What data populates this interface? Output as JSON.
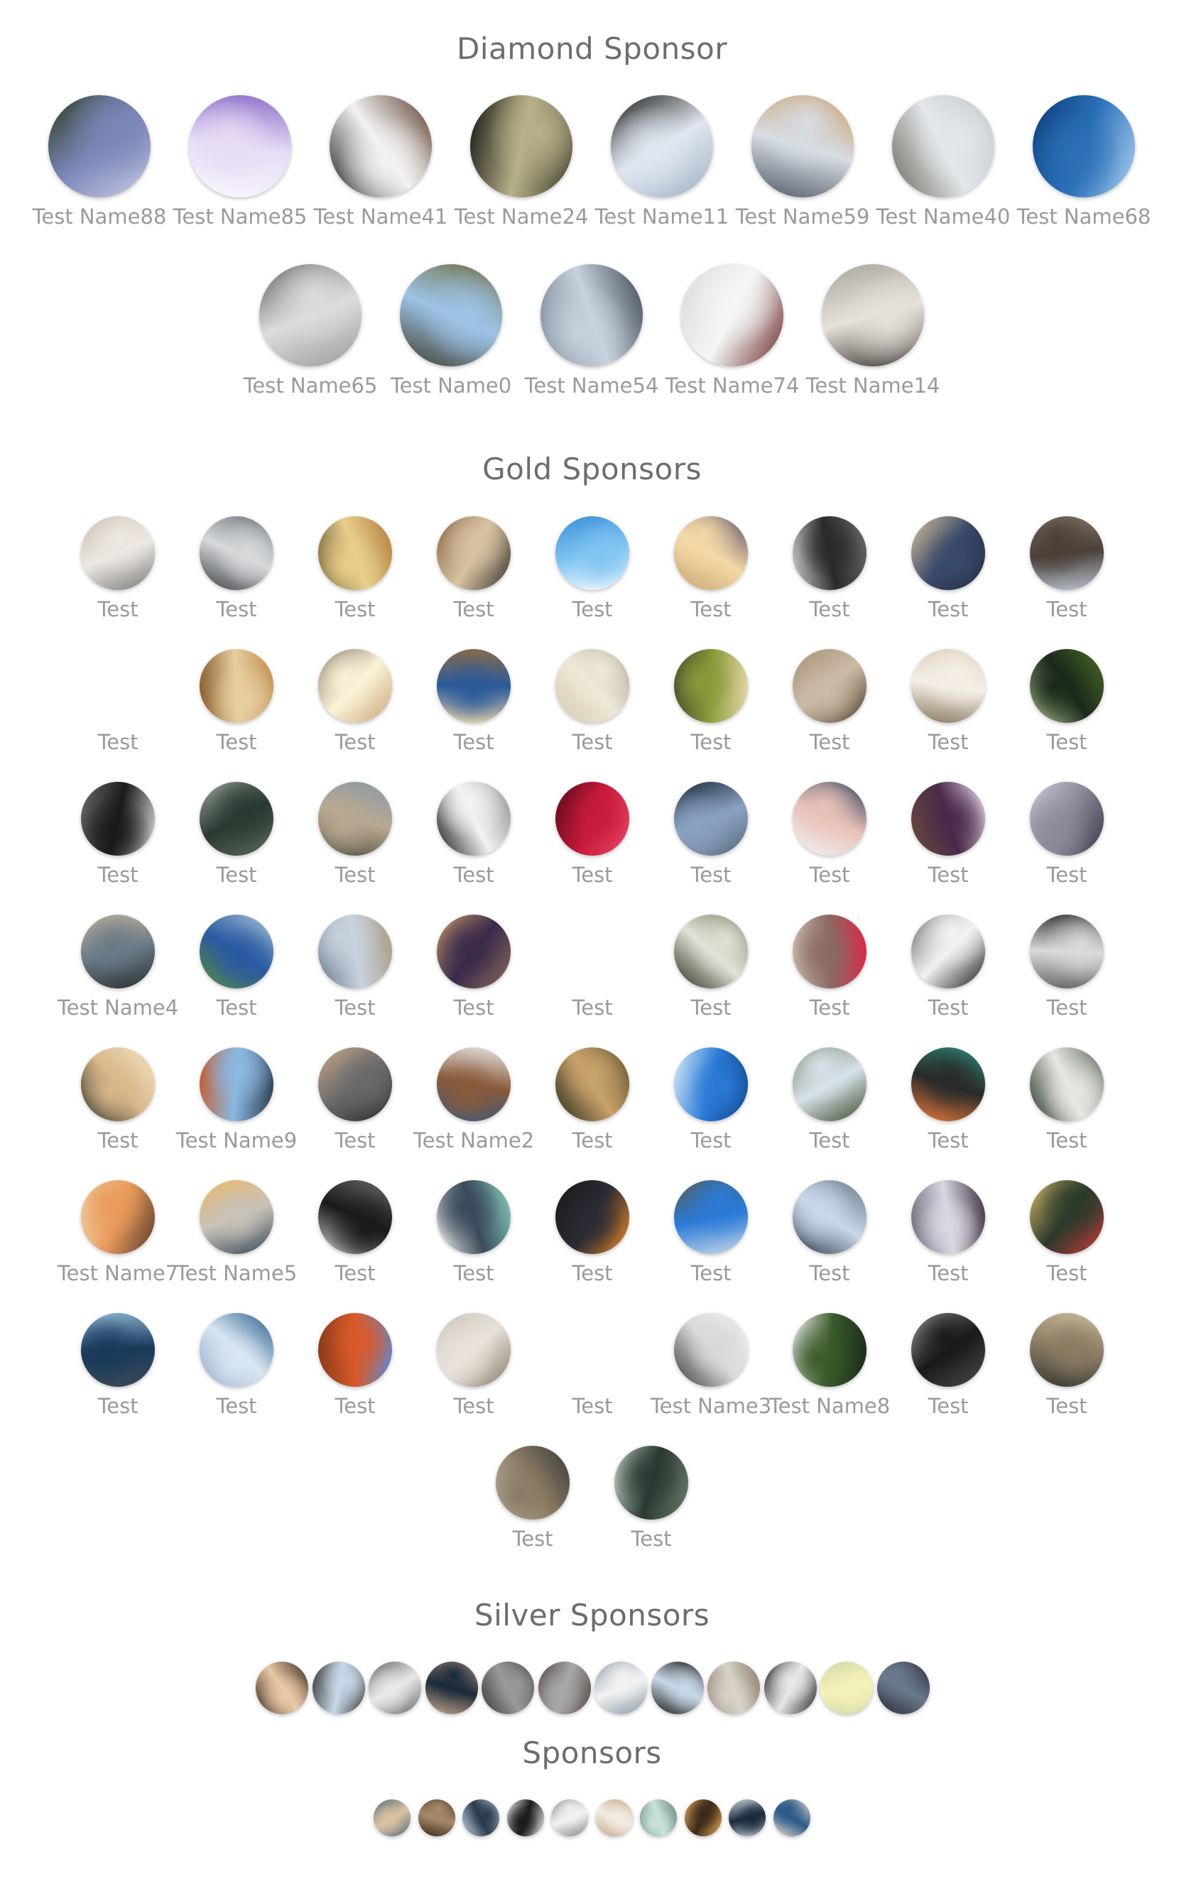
{
  "sections": {
    "diamond": "Diamond Sponsor",
    "gold": "Gold Sponsors",
    "silver": "Silver Sponsors",
    "sponsors": "Sponsors"
  },
  "diamond": [
    {
      "name": "Test Name88",
      "colors": [
        "#7b86b8",
        "#2a3a20",
        "#c9cde6"
      ]
    },
    {
      "name": "Test Name85",
      "colors": [
        "#e6dcf4",
        "#8c6fc9",
        "#f8f6ff"
      ]
    },
    {
      "name": "Test Name41",
      "colors": [
        "#f2f2f2",
        "#5a3a28",
        "#222222"
      ]
    },
    {
      "name": "Test Name24",
      "colors": [
        "#b8b08a",
        "#3b3b28",
        "#151510"
      ]
    },
    {
      "name": "Test Name11",
      "colors": [
        "#dfe6ef",
        "#9fb0c4",
        "#1b1b1b"
      ]
    },
    {
      "name": "Test Name59",
      "colors": [
        "#d7dde4",
        "#4f5a66",
        "#c7833a"
      ]
    },
    {
      "name": "Test Name40",
      "colors": [
        "#e3e6ea",
        "#6a6a5a",
        "#b8bcc2"
      ]
    },
    {
      "name": "Test Name68",
      "colors": [
        "#2b6fb7",
        "#0c3a78",
        "#a9d0f2"
      ]
    },
    {
      "name": "Test Name65",
      "colors": [
        "#dcdcdc",
        "#5a5a5a",
        "#9a9a9a"
      ]
    },
    {
      "name": "Test Name0",
      "colors": [
        "#9ec3e6",
        "#6b6a3a",
        "#3a3a2a"
      ]
    },
    {
      "name": "Test Name54",
      "colors": [
        "#c6d2de",
        "#3d4754",
        "#6b7a88"
      ]
    },
    {
      "name": "Test Name74",
      "colors": [
        "#f5f5f5",
        "#6a2a2a",
        "#d8d8d8"
      ]
    },
    {
      "name": "Test Name14",
      "colors": [
        "#e6e2da",
        "#3a3530",
        "#aaa59a"
      ]
    }
  ],
  "gold": [
    {
      "name": "Test",
      "colors": [
        "#ece8e2",
        "#c8b8a8",
        "#7a7a7a"
      ]
    },
    {
      "name": "Test",
      "colors": [
        "#d6d8da",
        "#6b7078",
        "#3a3d42"
      ]
    },
    {
      "name": "Test",
      "colors": [
        "#e8cf8a",
        "#b07a3a",
        "#5a4a2a"
      ]
    },
    {
      "name": "Test",
      "colors": [
        "#d8c2a2",
        "#3a3530",
        "#8a6a4a"
      ]
    },
    {
      "name": "Test",
      "colors": [
        "#7fc4f2",
        "#ffffff",
        "#3a8fd8"
      ]
    },
    {
      "name": "Test",
      "colors": [
        "#f2d9a6",
        "#c9a470",
        "#5a4a6a"
      ]
    },
    {
      "name": "Test",
      "colors": [
        "#2a2a2a",
        "#cfcfcf",
        "#6a6a6a"
      ]
    },
    {
      "name": "Test",
      "colors": [
        "#3a4a6a",
        "#d8c29a",
        "#1a2232"
      ]
    },
    {
      "name": "Test",
      "colors": [
        "#4a4038",
        "#8a7a68",
        "#b8c2d0"
      ]
    },
    {
      "name": "Test",
      "colors": [],
      "blank": true
    },
    {
      "name": "Test",
      "colors": [
        "#e6cfa0",
        "#c08a4a",
        "#8a5a2a"
      ]
    },
    {
      "name": "Test",
      "colors": [
        "#fbf3d8",
        "#caa67a",
        "#6a5a4a"
      ]
    },
    {
      "name": "Test",
      "colors": [
        "#2a5a9a",
        "#d8c8a8",
        "#8a6a4a"
      ]
    },
    {
      "name": "Test",
      "colors": [
        "#eee8d6",
        "#d2c9b0",
        "#9a9580"
      ]
    },
    {
      "name": "Test",
      "colors": [
        "#8a9a3a",
        "#3a3a2a",
        "#e8d8a8"
      ]
    },
    {
      "name": "Test",
      "colors": [
        "#cbbba6",
        "#a89278",
        "#4a3a2a"
      ]
    },
    {
      "name": "Test",
      "colors": [
        "#f4efe6",
        "#d8cbb4",
        "#8a7a62"
      ]
    },
    {
      "name": "Test",
      "colors": [
        "#1a2a1a",
        "#4a6a2a",
        "#b8c89a"
      ]
    },
    {
      "name": "Test",
      "colors": [
        "#1a1a1a",
        "#d8d8d8",
        "#6a6a6a"
      ]
    },
    {
      "name": "Test",
      "colors": [
        "#2a3a32",
        "#5a6a5a",
        "#9aa29a"
      ]
    },
    {
      "name": "Test",
      "colors": [
        "#b8a890",
        "#4a4a3a",
        "#8a9aa8"
      ]
    },
    {
      "name": "Test",
      "colors": [
        "#f2f2f2",
        "#1a1a1a",
        "#8a8a8a"
      ]
    },
    {
      "name": "Test",
      "colors": [
        "#c81a3a",
        "#5a0a1a",
        "#e84a6a"
      ]
    },
    {
      "name": "Test",
      "colors": [
        "#8aa2c2",
        "#1a2a3a",
        "#5a6a7a"
      ]
    },
    {
      "name": "Test",
      "colors": [
        "#e8c2b8",
        "#2a3a5a",
        "#f2f2f2"
      ]
    },
    {
      "name": "Test",
      "colors": [
        "#4a2a4a",
        "#e8d8e8",
        "#6a4a3a"
      ]
    },
    {
      "name": "Test",
      "colors": [
        "#8a8a9a",
        "#3a3a4a",
        "#c8c8d8"
      ]
    },
    {
      "name": "Test Name4",
      "colors": [
        "#6a7a88",
        "#2a3032",
        "#c8b89a"
      ]
    },
    {
      "name": "Test",
      "colors": [
        "#2a5aa2",
        "#5a8a3a",
        "#a8c2d8"
      ]
    },
    {
      "name": "Test",
      "colors": [
        "#c8d2de",
        "#6a7a8a",
        "#a89a80"
      ]
    },
    {
      "name": "Test",
      "colors": [
        "#3a2a4a",
        "#c89a6a",
        "#8a6a5a"
      ]
    },
    {
      "name": "Test",
      "colors": [],
      "blank": true
    },
    {
      "name": "Test",
      "colors": [
        "#e0e4d8",
        "#5a5a3a",
        "#2a2a1a"
      ]
    },
    {
      "name": "Test",
      "colors": [
        "#8a6a62",
        "#d82a4a",
        "#c8b8a8"
      ]
    },
    {
      "name": "Test",
      "colors": [
        "#f2f2f2",
        "#1a1a1a",
        "#6a6a6a"
      ]
    },
    {
      "name": "Test",
      "colors": [
        "#d8dadc",
        "#6a6a6a",
        "#3a3a3a"
      ]
    },
    {
      "name": "Test",
      "colors": [
        "#d8b88a",
        "#1a1a1a",
        "#f2e2c2"
      ]
    },
    {
      "name": "Test Name9",
      "colors": [
        "#8ab8e2",
        "#c85a2a",
        "#2a3a4a"
      ]
    },
    {
      "name": "Test",
      "colors": [
        "#6a6a6a",
        "#c8a88a",
        "#2a2a2a"
      ]
    },
    {
      "name": "Test Name2",
      "colors": [
        "#8a5a3a",
        "#e8e8e8",
        "#2a5a8a"
      ]
    },
    {
      "name": "Test",
      "colors": [
        "#c8a26a",
        "#5a4a2a",
        "#2a2a1a"
      ]
    },
    {
      "name": "Test",
      "colors": [
        "#2a7ad8",
        "#0a3a78",
        "#d8ecf8"
      ]
    },
    {
      "name": "Test",
      "colors": [
        "#d8e2ea",
        "#3a4a2a",
        "#5a6a4a"
      ]
    },
    {
      "name": "Test",
      "colors": [
        "#2a2a2a",
        "#e87a3a",
        "#2a8a7a"
      ]
    },
    {
      "name": "Test",
      "colors": [
        "#e8e6e2",
        "#2a3a2a",
        "#5a6a5a"
      ]
    },
    {
      "name": "Test Name7",
      "colors": [
        "#e89a5a",
        "#f2e2c2",
        "#5a3a2a"
      ]
    },
    {
      "name": "Test Name5",
      "colors": [
        "#c8c2b8",
        "#e8b86a",
        "#3a4a5a"
      ]
    },
    {
      "name": "Test",
      "colors": [
        "#1a1a1a",
        "#6a6a6a",
        "#c8c8c8"
      ]
    },
    {
      "name": "Test",
      "colors": [
        "#3a4a5a",
        "#8ad2c2",
        "#f2f2f2"
      ]
    },
    {
      "name": "Test",
      "colors": [
        "#2a2a32",
        "#e88a2a",
        "#1a1a1a"
      ]
    },
    {
      "name": "Test",
      "colors": [
        "#2a7ad8",
        "#c8d8e8",
        "#5a5a4a"
      ]
    },
    {
      "name": "Test",
      "colors": [
        "#c8d8e8",
        "#2a3a4a",
        "#6a7a8a"
      ]
    },
    {
      "name": "Test",
      "colors": [
        "#d8d8e2",
        "#6a6a7a",
        "#3a2a3a"
      ]
    },
    {
      "name": "Test",
      "colors": [
        "#2a3a2a",
        "#d8b86a",
        "#c83a3a"
      ]
    },
    {
      "name": "Test",
      "colors": [
        "#1a3a5a",
        "#8ab2d2",
        "#3a4a5a"
      ]
    },
    {
      "name": "Test",
      "colors": [
        "#d8e6f2",
        "#2a5a8a",
        "#8aa2c2"
      ]
    },
    {
      "name": "Test",
      "colors": [
        "#d85a2a",
        "#5a8ad8",
        "#8a3a1a"
      ]
    },
    {
      "name": "Test",
      "colors": [
        "#e8e2da",
        "#8a7a6a",
        "#c8c2b8"
      ]
    },
    {
      "name": "Test",
      "colors": [],
      "blank": true
    },
    {
      "name": "Test Name3",
      "colors": [
        "#d8d8d8",
        "#3a3a3a",
        "#f2f2f2"
      ]
    },
    {
      "name": "Test Name8",
      "colors": [
        "#3a5a2a",
        "#f2f2f2",
        "#1a2a1a"
      ]
    },
    {
      "name": "Test",
      "colors": [
        "#1a1a1a",
        "#a8a8a8",
        "#4a4a4a"
      ]
    },
    {
      "name": "Test",
      "colors": [
        "#8a7a62",
        "#c8b89a",
        "#3a3a32"
      ]
    },
    {
      "name": "Test",
      "colors": [
        "#8a7a62",
        "#3a3a3a",
        "#c8c2b8"
      ]
    },
    {
      "name": "Test",
      "colors": [
        "#2a3a32",
        "#6a7a6a",
        "#c8d2c8"
      ]
    }
  ],
  "silver": [
    {
      "colors": [
        "#e8c8a8",
        "#3a2a1a"
      ]
    },
    {
      "colors": [
        "#c8d8e8",
        "#3a3a3a"
      ]
    },
    {
      "colors": [
        "#e8e8e8",
        "#6a6a6a"
      ]
    },
    {
      "colors": [
        "#1a2a3a",
        "#c8a88a"
      ]
    },
    {
      "colors": [
        "#9a9a9a",
        "#3a3a3a"
      ]
    },
    {
      "colors": [
        "#a8a8a8",
        "#5a4a4a"
      ]
    },
    {
      "colors": [
        "#f2f2f2",
        "#8a9aa8"
      ]
    },
    {
      "colors": [
        "#c8d8e8",
        "#1a1a1a"
      ]
    },
    {
      "colors": [
        "#d8d2c8",
        "#8a7a6a"
      ]
    },
    {
      "colors": [
        "#e8e8e8",
        "#2a2a2a"
      ]
    },
    {
      "colors": [
        "#f2f2b8",
        "#d8d8a8"
      ]
    },
    {
      "colors": [
        "#6a7a8a",
        "#2a2a3a"
      ]
    }
  ],
  "sponsors": [
    {
      "colors": [
        "#d8c2a2",
        "#5a6a7a"
      ]
    },
    {
      "colors": [
        "#a88a6a",
        "#3a2a1a"
      ]
    },
    {
      "colors": [
        "#2a3a4a",
        "#c8d8e8"
      ]
    },
    {
      "colors": [
        "#1a1a1a",
        "#e8e8e8"
      ]
    },
    {
      "colors": [
        "#f2f2f2",
        "#8a8a8a"
      ]
    },
    {
      "colors": [
        "#f2ece2",
        "#c8a88a"
      ]
    },
    {
      "colors": [
        "#c8e2d8",
        "#6a8a7a"
      ]
    },
    {
      "colors": [
        "#3a2a1a",
        "#e8a85a"
      ]
    },
    {
      "colors": [
        "#1a2a3a",
        "#c8d2de"
      ]
    },
    {
      "colors": [
        "#2a5a8a",
        "#e8d8c8"
      ]
    }
  ]
}
